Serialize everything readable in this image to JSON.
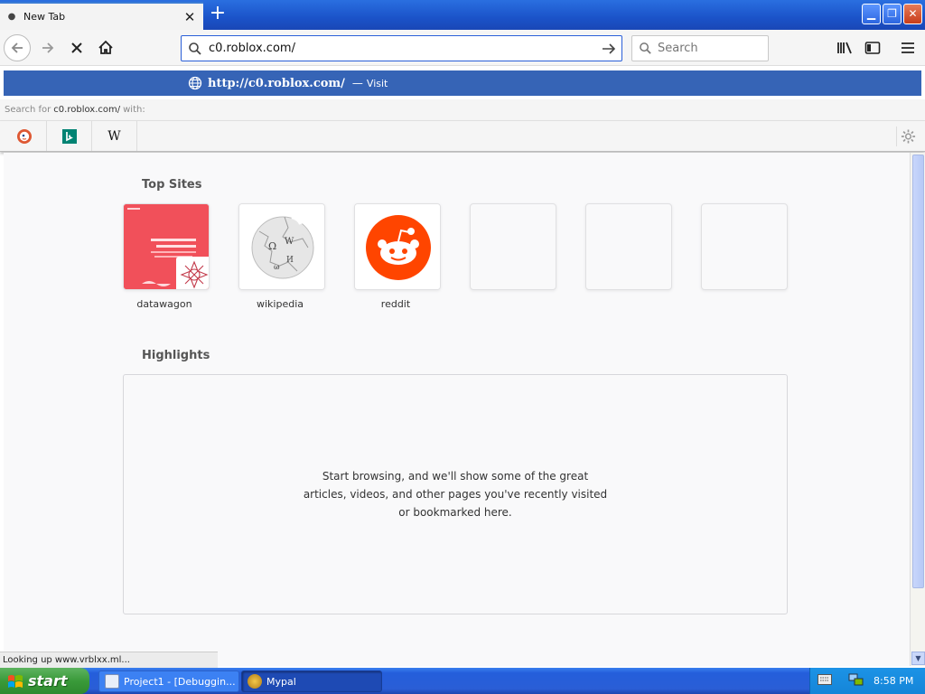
{
  "tab": {
    "title": "New Tab",
    "favicon": "loading-dot-icon",
    "close_icon": "close-icon"
  },
  "new_tab_icon": "plus-icon",
  "window_controls": {
    "minimize": "minimize-icon",
    "maximize": "restore-icon",
    "close": "close-x-icon"
  },
  "toolbar": {
    "back_icon": "arrow-left-icon",
    "forward_icon": "arrow-right-icon",
    "stop_icon": "stop-x-icon",
    "home_icon": "home-icon",
    "url_value": "c0.roblox.com/",
    "go_icon": "arrow-go-icon",
    "search_placeholder": "Search",
    "library_icon": "library-icon",
    "sidebar_icon": "sidebar-icon",
    "menu_icon": "hamburger-icon"
  },
  "url_dropdown": {
    "visit_url": "http://c0.roblox.com/",
    "visit_dash": "—",
    "visit_label": "Visit",
    "search_for_prefix": "Search for",
    "search_for_query": "c0.roblox.com/",
    "search_for_suffix": "with:",
    "engines": [
      "duckduckgo-icon",
      "bing-icon",
      "wikipedia-icon"
    ],
    "wiki_letter": "W",
    "settings_icon": "gear-icon"
  },
  "newtab": {
    "top_sites_title": "Top Sites",
    "top_sites": [
      {
        "label": "datawagon"
      },
      {
        "label": "wikipedia"
      },
      {
        "label": "reddit"
      }
    ],
    "highlights_title": "Highlights",
    "highlights_empty": "Start browsing, and we'll show some of the great articles, videos, and other pages you've recently visited or bookmarked here."
  },
  "status_text": "Looking up www.vrblxx.ml...",
  "taskbar": {
    "start_label": "start",
    "tasks": [
      {
        "label": "Project1 - [Debuggin..."
      },
      {
        "label": "Mypal"
      }
    ],
    "clock": "8:58 PM"
  },
  "colors": {
    "titlebar_blue": "#1b53c9",
    "visit_row_blue": "#3664b6",
    "reddit_orange": "#ff4500",
    "datawagon_red": "#f1505a",
    "start_green": "#3a9a3a"
  }
}
